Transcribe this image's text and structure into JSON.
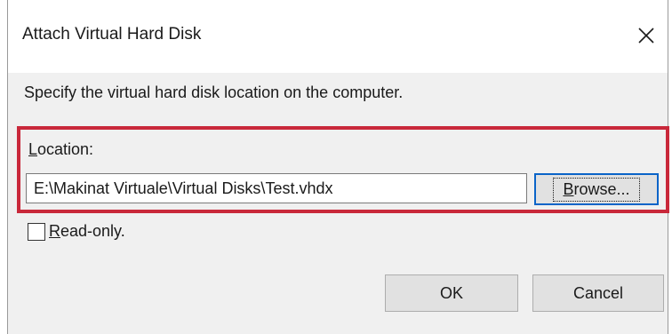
{
  "dialog": {
    "title": "Attach Virtual Hard Disk",
    "close_icon": "close-icon",
    "instruction": "Specify the virtual hard disk location on the computer.",
    "location": {
      "label_access_key": "L",
      "label_rest": "ocation:",
      "value": "E:\\Makinat Virtuale\\Virtual Disks\\Test.vhdx"
    },
    "browse_button": {
      "access_key": "B",
      "label_rest": "rowse..."
    },
    "read_only": {
      "access_key": "R",
      "label_rest": "ead-only.",
      "checked": false
    },
    "ok_label": "OK",
    "cancel_label": "Cancel"
  },
  "colors": {
    "highlight": "#c9283a",
    "focus_border": "#0a64c8",
    "dialog_bg": "#f0f0f0"
  }
}
